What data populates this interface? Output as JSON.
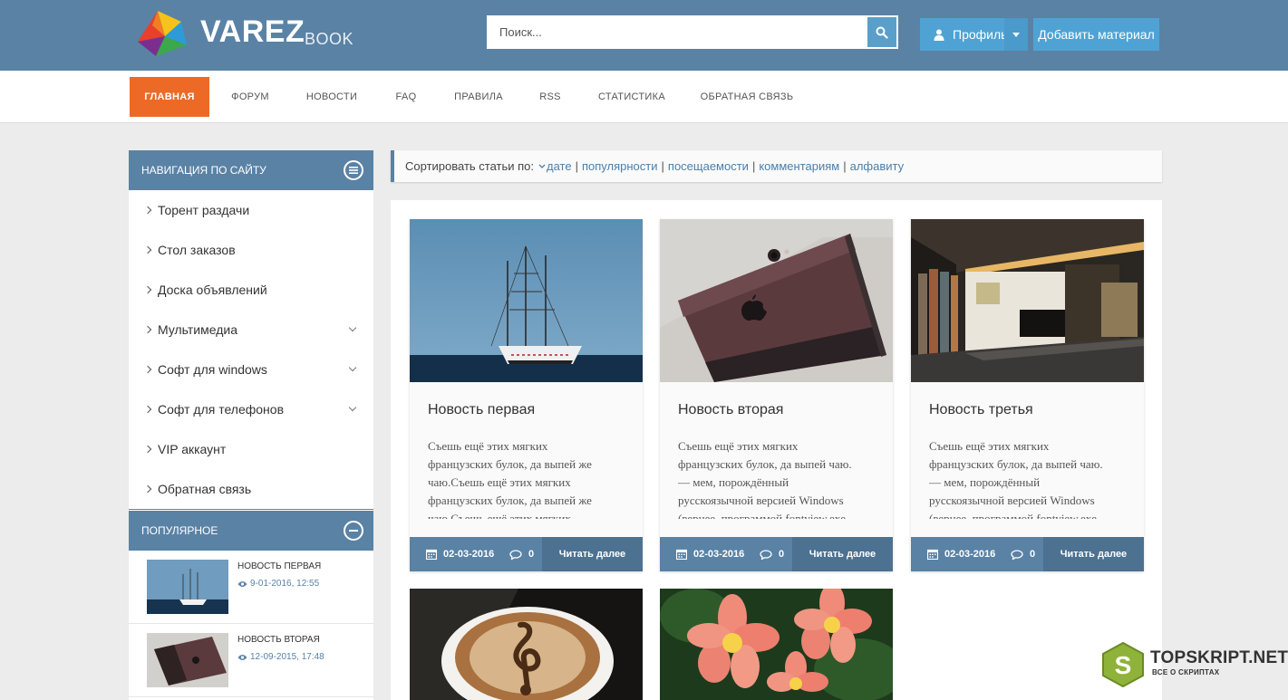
{
  "header": {
    "logo_text": "VAREZ",
    "logo_sub": "BOOK",
    "search_placeholder": "Поиск...",
    "profile_label": "Профиль",
    "add_label": "Добавить материал",
    "colors": {
      "header_bg": "#5a82a5",
      "button_bg": "#4fa3d4",
      "accent": "#ec6a26"
    }
  },
  "nav": {
    "items": [
      {
        "label": "ГЛАВНАЯ",
        "active": true
      },
      {
        "label": "ФОРУМ"
      },
      {
        "label": "НОВОСТИ"
      },
      {
        "label": "FAQ"
      },
      {
        "label": "ПРАВИЛА"
      },
      {
        "label": "RSS"
      },
      {
        "label": "СТАТИСТИКА"
      },
      {
        "label": "ОБРАТНАЯ СВЯЗЬ"
      }
    ]
  },
  "sidebar": {
    "nav_title": "НАВИГАЦИЯ ПО САЙТУ",
    "items": [
      {
        "label": "Торент раздачи",
        "has_sub": false
      },
      {
        "label": "Стол заказов",
        "has_sub": false
      },
      {
        "label": "Доска объявлений",
        "has_sub": false
      },
      {
        "label": "Мультимедиа",
        "has_sub": true
      },
      {
        "label": "Софт для windows",
        "has_sub": true
      },
      {
        "label": "Софт для телефонов",
        "has_sub": true
      },
      {
        "label": "VIP аккаунт",
        "has_sub": false
      },
      {
        "label": "Обратная связь",
        "has_sub": false
      }
    ],
    "popular_title": "ПОПУЛЯРНОЕ",
    "popular": [
      {
        "title": "НОВОСТЬ ПЕРВАЯ",
        "date": "9-01-2016, 12:55",
        "image": "ship"
      },
      {
        "title": "НОВОСТЬ ВТОРАЯ",
        "date": "12-09-2015, 17:48",
        "image": "phone"
      }
    ]
  },
  "sort": {
    "label": "Сортировать статьи по:",
    "options": [
      "дате",
      "популярности",
      "посещаемости",
      "комментариям",
      "алфавиту"
    ]
  },
  "articles": [
    {
      "title": "Новость первая",
      "text": "Съешь ещё этих мягких французских булок, да выпей же чаю.Съешь ещё этих мягких французских булок, да выпей же чаю.Съешь ещё этих мягких",
      "date": "02-03-2016",
      "comments": "0",
      "read_more": "Читать далее",
      "image": "ship"
    },
    {
      "title": "Новость вторая",
      "text": "Съешь ещё этих мягких французских булок, да выпей чаю. — мем, порождённый русскоязычной версией Windows (вернее, программой fontview.exe",
      "date": "02-03-2016",
      "comments": "0",
      "read_more": "Читать далее",
      "image": "phone"
    },
    {
      "title": "Новость третья",
      "text": "Съешь ещё этих мягких французских булок, да выпей чаю. — мем, порождённый русскоязычной версией Windows (вернее, программой fontview.exe",
      "date": "02-03-2016",
      "comments": "0",
      "read_more": "Читать далее",
      "image": "interior"
    }
  ],
  "extra_images": [
    "coffee",
    "flowers"
  ],
  "watermark": {
    "brand": "TOPSKRIPT.NET",
    "tagline": "ВСЕ О СКРИПТАХ"
  }
}
